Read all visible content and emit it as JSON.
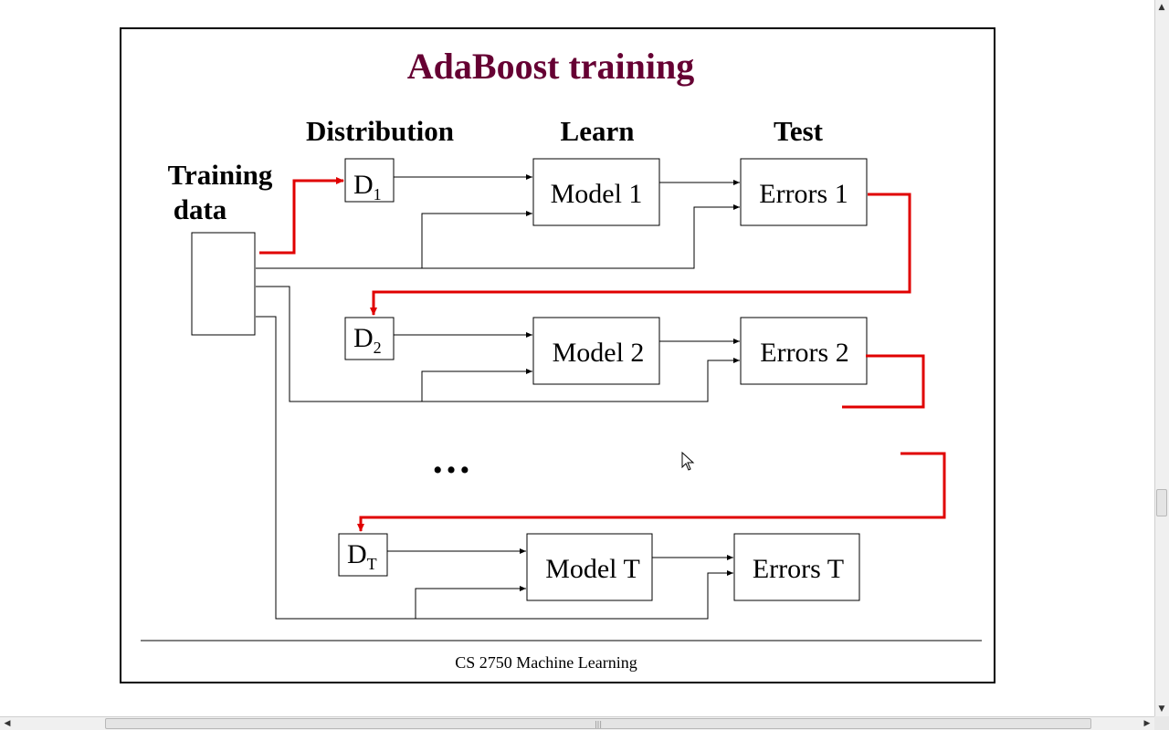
{
  "slide": {
    "title": "AdaBoost training",
    "title_color": "#660033",
    "footer": "CS 2750 Machine Learning",
    "headers": {
      "distribution": "Distribution",
      "learn": "Learn",
      "test": "Test"
    },
    "training_data_label_line1": "Training",
    "training_data_label_line2": "data",
    "rounds": [
      {
        "dist_letter": "D",
        "dist_sub": "1",
        "model": "Model 1",
        "errors": "Errors 1"
      },
      {
        "dist_letter": "D",
        "dist_sub": "2",
        "model": "Model 2",
        "errors": "Errors 2"
      },
      {
        "dist_letter": "D",
        "dist_sub": "T",
        "model": "Model T",
        "errors": "Errors T"
      }
    ],
    "ellipsis": "…",
    "feedback_color": "#e00000"
  },
  "scrollbars": {
    "up_icon": "triangle-up-icon",
    "down_icon": "triangle-down-icon",
    "left_icon": "triangle-left-icon",
    "right_icon": "triangle-right-icon",
    "grip": "|||"
  }
}
